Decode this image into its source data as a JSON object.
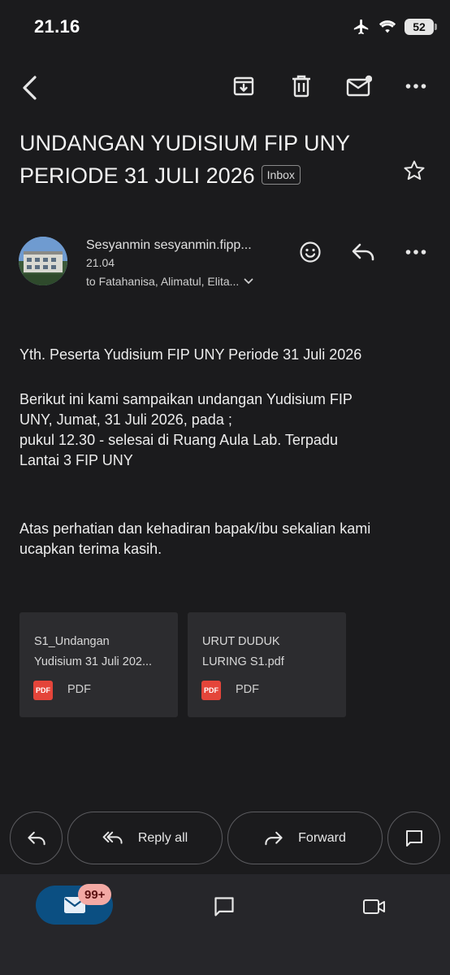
{
  "status": {
    "time": "21.16",
    "battery": "52"
  },
  "email": {
    "subject": "UNDANGAN YUDISIUM FIP UNY PERIODE 31 JULI 2026",
    "label": "Inbox",
    "sender": "Sesyanmin sesyanmin.fipp...",
    "time": "21.04",
    "recipients": "to Fatahanisa, Alimatul, Elita...",
    "body": {
      "greeting": "Yth. Peserta Yudisium FIP UNY Periode 31 Juli 2026",
      "para1_line1": "Berikut ini kami sampaikan undangan Yudisium FIP",
      "para1_line2": "UNY, Jumat, 31 Juli 2026, pada ;",
      "para1_line3": "pukul 12.30 - selesai di Ruang Aula Lab. Terpadu",
      "para1_line4": "Lantai 3 FIP UNY",
      "para2_line1": "Atas perhatian dan kehadiran bapak/ibu sekalian kami",
      "para2_line2": "ucapkan terima kasih."
    },
    "attachments": [
      {
        "line1": "S1_Undangan",
        "line2": "Yudisium 31 Juli 202...",
        "icon": "PDF",
        "type": "PDF"
      },
      {
        "line1": "URUT DUDUK",
        "line2": "LURING S1.pdf",
        "icon": "PDF",
        "type": "PDF"
      }
    ]
  },
  "actions": {
    "reply_all": "Reply all",
    "forward": "Forward"
  },
  "nav": {
    "mail_badge": "99+"
  },
  "colors": {
    "background": "#1b1b1d",
    "accent": "#0b4f82",
    "badge": "#f3a9a4",
    "pdf": "#e4453a"
  }
}
